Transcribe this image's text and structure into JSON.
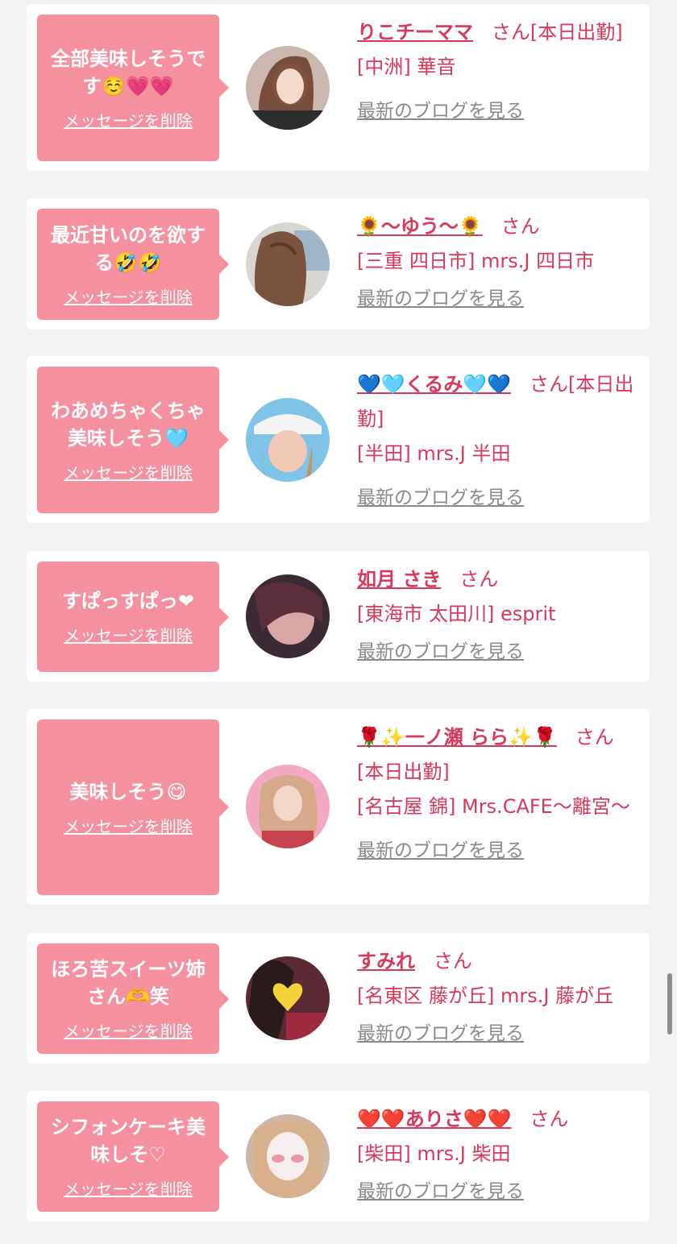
{
  "delete_label": "メッセージを削除",
  "blog_label": "最新のブログを見る",
  "san_label": "さん",
  "colors": {
    "bubble": "#f5909f",
    "accent": "#d9385a",
    "link_gray": "#8a8a8a",
    "background": "#f3f3f3"
  },
  "items": [
    {
      "message": "全部美味しそうです☺️💗💗",
      "name": "りこチーママ",
      "status": "[本日出勤]",
      "shop": "[中洲] 華音"
    },
    {
      "message": "最近甘いのを欲する🤣🤣",
      "name": "🌻〜ゆう〜🌻",
      "status": "",
      "shop": "[三重 四日市] mrs.J 四日市"
    },
    {
      "message": "わあめちゃくちゃ美味しそう🩵",
      "name": "💙🩵くるみ🩵💙",
      "status": "[本日出勤]",
      "shop": "[半田] mrs.J 半田"
    },
    {
      "message": "すぱっすぱっ❤",
      "name": "如月 さき",
      "status": "",
      "shop": "[東海市 太田川] esprit"
    },
    {
      "message": "美味しそう😋",
      "name": "🌹✨一ノ瀬 らら✨🌹",
      "status": "[本日出勤]",
      "shop": "[名古屋 錦] Mrs.CAFE〜離宮〜"
    },
    {
      "message": "ほろ苦スイーツ姉さん🫶笑",
      "name": "すみれ",
      "status": "",
      "shop": "[名東区 藤が丘] mrs.J 藤が丘"
    },
    {
      "message": "シフォンケーキ美味しそ♡",
      "name": "❤️❤️ありさ❤️❤️",
      "status": "",
      "shop": "[柴田] mrs.J 柴田"
    }
  ]
}
